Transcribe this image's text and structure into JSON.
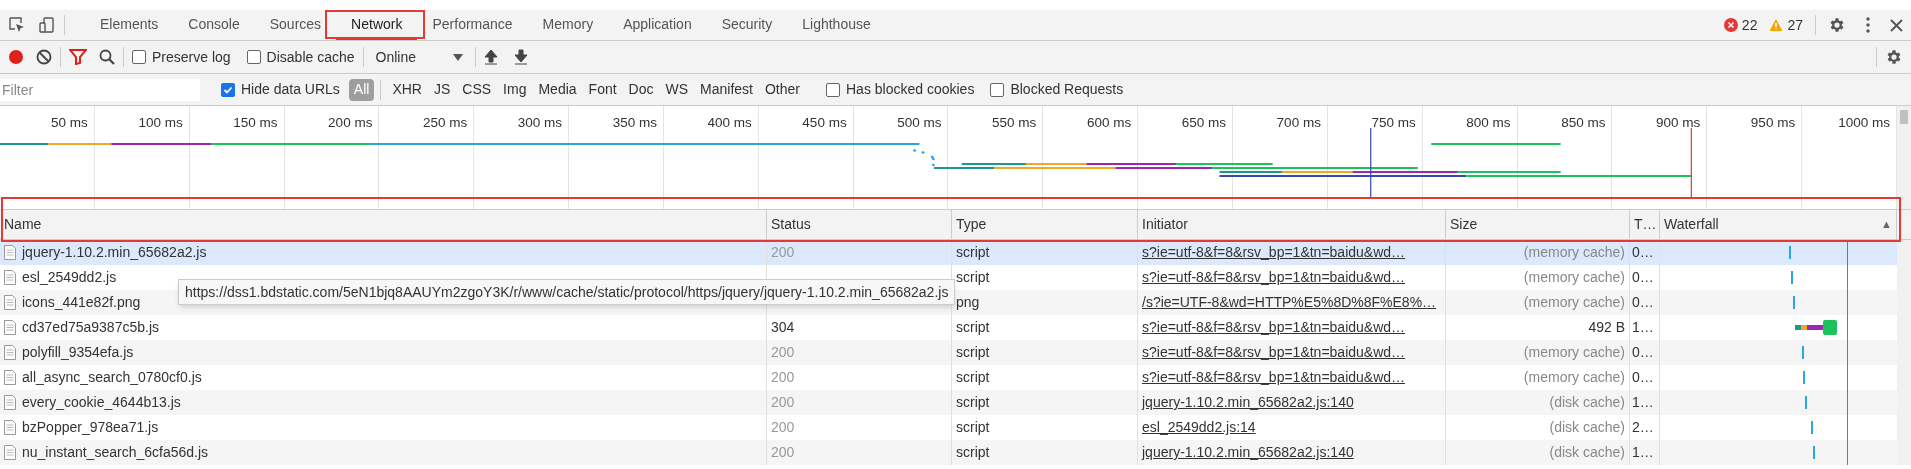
{
  "tabs": [
    {
      "label": "Elements",
      "selected": false
    },
    {
      "label": "Console",
      "selected": false
    },
    {
      "label": "Sources",
      "selected": false
    },
    {
      "label": "Network",
      "selected": true
    },
    {
      "label": "Performance",
      "selected": false
    },
    {
      "label": "Memory",
      "selected": false
    },
    {
      "label": "Application",
      "selected": false
    },
    {
      "label": "Security",
      "selected": false
    },
    {
      "label": "Lighthouse",
      "selected": false
    }
  ],
  "counts": {
    "errors": "22",
    "warnings": "27"
  },
  "toolbar": {
    "recording": true,
    "filter_active": true,
    "preserve_log": {
      "label": "Preserve log",
      "checked": false
    },
    "disable_cache": {
      "label": "Disable cache",
      "checked": false
    },
    "throttling": "Online"
  },
  "filter_bar": {
    "placeholder": "Filter",
    "hide_data_urls": {
      "label": "Hide data URLs",
      "checked": true
    },
    "types": [
      {
        "label": "All",
        "selected": true
      },
      {
        "label": "XHR",
        "selected": false
      },
      {
        "label": "JS",
        "selected": false
      },
      {
        "label": "CSS",
        "selected": false
      },
      {
        "label": "Img",
        "selected": false
      },
      {
        "label": "Media",
        "selected": false
      },
      {
        "label": "Font",
        "selected": false
      },
      {
        "label": "Doc",
        "selected": false
      },
      {
        "label": "WS",
        "selected": false
      },
      {
        "label": "Manifest",
        "selected": false
      },
      {
        "label": "Other",
        "selected": false
      }
    ],
    "has_blocked_cookies": {
      "label": "Has blocked cookies",
      "checked": false
    },
    "blocked_requests": {
      "label": "Blocked Requests",
      "checked": false
    }
  },
  "overview_ticks": [
    "50 ms",
    "100 ms",
    "150 ms",
    "200 ms",
    "250 ms",
    "300 ms",
    "350 ms",
    "400 ms",
    "450 ms",
    "500 ms",
    "550 ms",
    "600 ms",
    "650 ms",
    "700 ms",
    "750 ms",
    "800 ms",
    "850 ms",
    "900 ms",
    "950 ms",
    "1000 ms"
  ],
  "table": {
    "columns": [
      "Name",
      "Status",
      "Type",
      "Initiator",
      "Size",
      "T…",
      "Waterfall"
    ],
    "sort_indicator": "▲",
    "rows": [
      {
        "name": "jquery-1.10.2.min_65682a2.js",
        "status": "200",
        "type": "script",
        "initiator": "s?ie=utf-8&f=8&rsv_bp=1&tn=baidu&wd…",
        "size": "(memory cache)",
        "time": "0…",
        "from_cache": true,
        "selected": true
      },
      {
        "name": "esl_2549dd2.js",
        "type": "script",
        "initiator": "s?ie=utf-8&f=8&rsv_bp=1&tn=baidu&wd…",
        "size": "(memory cache)",
        "time": "0…",
        "from_cache": true,
        "selected": false
      },
      {
        "name": "icons_441e82f.png",
        "type": "png",
        "initiator": "/s?ie=UTF-8&wd=HTTP%E5%8D%8F%E8%…",
        "size": "(memory cache)",
        "time": "0…",
        "from_cache": true,
        "selected": false
      },
      {
        "name": "cd37ed75a9387c5b.js",
        "status": "304",
        "type": "script",
        "initiator": "s?ie=utf-8&f=8&rsv_bp=1&tn=baidu&wd…",
        "size": "492 B",
        "time": "1…",
        "from_cache": false,
        "selected": false
      },
      {
        "name": "polyfill_9354efa.js",
        "status": "200",
        "type": "script",
        "initiator": "s?ie=utf-8&f=8&rsv_bp=1&tn=baidu&wd…",
        "size": "(memory cache)",
        "time": "0…",
        "from_cache": true,
        "selected": false
      },
      {
        "name": "all_async_search_0780cf0.js",
        "status": "200",
        "type": "script",
        "initiator": "s?ie=utf-8&f=8&rsv_bp=1&tn=baidu&wd…",
        "size": "(memory cache)",
        "time": "0…",
        "from_cache": true,
        "selected": false
      },
      {
        "name": "every_cookie_4644b13.js",
        "status": "200",
        "type": "script",
        "initiator": "jquery-1.10.2.min_65682a2.js:140",
        "size": "(disk cache)",
        "time": "1…",
        "from_cache": true,
        "selected": false
      },
      {
        "name": "bzPopper_978ea71.js",
        "status": "200",
        "type": "script",
        "initiator": "esl_2549dd2.js:14",
        "size": "(disk cache)",
        "time": "2…",
        "from_cache": true,
        "selected": false
      },
      {
        "name": "nu_instant_search_6cfa56d.js",
        "status": "200",
        "type": "script",
        "initiator": "jquery-1.10.2.min_65682a2.js:140",
        "size": "(disk cache)",
        "time": "1…",
        "from_cache": true,
        "selected": false
      }
    ]
  },
  "tooltip": "https://dss1.bdstatic.com/5eN1bjq8AAUYm2zgoY3K/r/www/cache/static/protocol/https/jquery/jquery-1.10.2.min_65682a2.js"
}
